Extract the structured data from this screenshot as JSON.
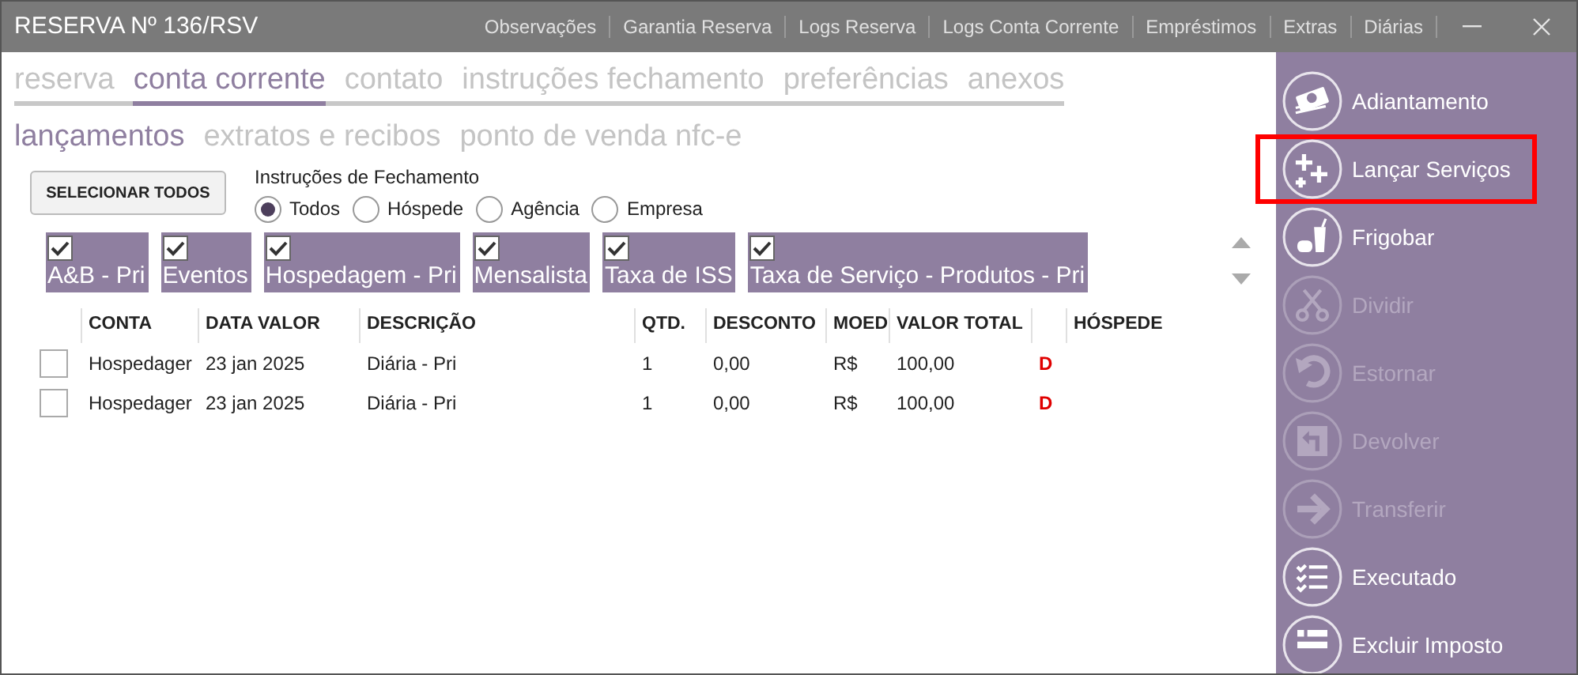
{
  "window": {
    "title": "RESERVA Nº 136/RSV",
    "menu": [
      "Observações",
      "Garantia Reserva",
      "Logs Reserva",
      "Logs Conta Corrente",
      "Empréstimos",
      "Extras",
      "Diárias"
    ]
  },
  "tabs": [
    {
      "label": "reserva",
      "selected": false
    },
    {
      "label": "conta corrente",
      "selected": true
    },
    {
      "label": "contato",
      "selected": false
    },
    {
      "label": "instruções fechamento",
      "selected": false
    },
    {
      "label": "preferências",
      "selected": false
    },
    {
      "label": "anexos",
      "selected": false
    }
  ],
  "subtabs": [
    {
      "label": "lançamentos",
      "selected": true
    },
    {
      "label": "extratos e recibos",
      "selected": false
    },
    {
      "label": "ponto de venda nfc-e",
      "selected": false
    }
  ],
  "select_all_button": "SELECIONAR TODOS",
  "closing_instructions": {
    "label": "Instruções de Fechamento",
    "options": [
      {
        "label": "Todos",
        "selected": true
      },
      {
        "label": "Hóspede",
        "selected": false
      },
      {
        "label": "Agência",
        "selected": false
      },
      {
        "label": "Empresa",
        "selected": false
      }
    ]
  },
  "categories": [
    {
      "label": "A&B - Pri",
      "checked": true
    },
    {
      "label": "Eventos",
      "checked": true
    },
    {
      "label": "Hospedagem - Pri",
      "checked": true
    },
    {
      "label": "Mensalista",
      "checked": true
    },
    {
      "label": "Taxa de ISS",
      "checked": true
    },
    {
      "label": "Taxa de Serviço - Produtos - Pri",
      "checked": true
    }
  ],
  "table": {
    "columns": [
      "CONTA",
      "DATA VALOR",
      "DESCRIÇÃO",
      "QTD.",
      "DESCONTO",
      "MOED",
      "VALOR TOTAL",
      "HÓSPEDE"
    ],
    "rows": [
      {
        "checked": false,
        "cells": [
          "Hospedager",
          "23 jan 2025",
          "Diária - Pri",
          "1",
          "0,00",
          "R$",
          "100,00",
          "D",
          ""
        ]
      },
      {
        "checked": false,
        "cells": [
          "Hospedager",
          "23 jan 2025",
          "Diária - Pri",
          "1",
          "0,00",
          "R$",
          "100,00",
          "D",
          ""
        ]
      }
    ]
  },
  "actions": [
    {
      "label": "Adiantamento",
      "disabled": false,
      "highlighted": false
    },
    {
      "label": "Lançar Serviços",
      "disabled": false,
      "highlighted": true
    },
    {
      "label": "Frigobar",
      "disabled": false,
      "highlighted": false
    },
    {
      "label": "Dividir",
      "disabled": true,
      "highlighted": false
    },
    {
      "label": "Estornar",
      "disabled": true,
      "highlighted": false
    },
    {
      "label": "Devolver",
      "disabled": true,
      "highlighted": false
    },
    {
      "label": "Transferir",
      "disabled": true,
      "highlighted": false
    },
    {
      "label": "Executado",
      "disabled": false,
      "highlighted": false
    },
    {
      "label": "Excluir Imposto",
      "disabled": false,
      "highlighted": false
    }
  ]
}
